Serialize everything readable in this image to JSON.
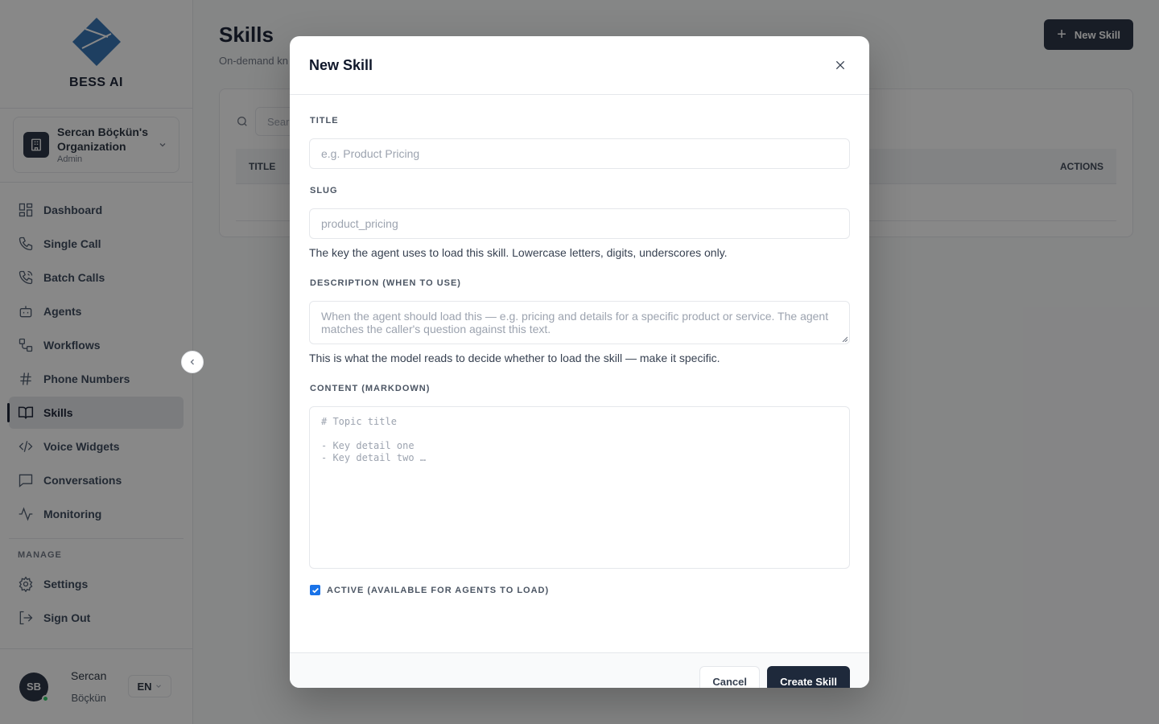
{
  "brand": {
    "name": "BESS AI"
  },
  "org": {
    "name": "Sercan Böçkün's Organization",
    "role": "Admin"
  },
  "nav": {
    "items": [
      {
        "label": "Dashboard",
        "icon": "dashboard-icon"
      },
      {
        "label": "Single Call",
        "icon": "phone-icon"
      },
      {
        "label": "Batch Calls",
        "icon": "phone-calls-icon"
      },
      {
        "label": "Agents",
        "icon": "bot-icon"
      },
      {
        "label": "Workflows",
        "icon": "workflow-icon"
      },
      {
        "label": "Phone Numbers",
        "icon": "hash-icon"
      },
      {
        "label": "Skills",
        "icon": "book-icon",
        "active": true
      },
      {
        "label": "Voice Widgets",
        "icon": "code-icon"
      },
      {
        "label": "Conversations",
        "icon": "chat-icon"
      },
      {
        "label": "Monitoring",
        "icon": "activity-icon"
      }
    ],
    "manage_label": "MANAGE",
    "manage_items": [
      {
        "label": "Settings",
        "icon": "gear-icon"
      },
      {
        "label": "Sign Out",
        "icon": "sign-out-icon"
      }
    ]
  },
  "user": {
    "initials": "SB",
    "first_name": "Sercan",
    "last_name": "Böçkün",
    "language": "EN"
  },
  "page": {
    "title": "Skills",
    "subtitle": "On-demand kn",
    "new_button": "New Skill",
    "search_placeholder": "Sear",
    "columns": {
      "title": "TITLE",
      "actions": "ACTIONS"
    }
  },
  "modal": {
    "title": "New Skill",
    "title_label": "TITLE",
    "title_placeholder": "e.g. Product Pricing",
    "slug_label": "SLUG",
    "slug_placeholder": "product_pricing",
    "slug_help": "The key the agent uses to load this skill. Lowercase letters, digits, underscores only.",
    "description_label": "DESCRIPTION (WHEN TO USE)",
    "description_placeholder": "When the agent should load this — e.g. pricing and details for a specific product or service. The agent matches the caller's question against this text.",
    "description_help": "This is what the model reads to decide whether to load the skill — make it specific.",
    "content_label": "CONTENT (MARKDOWN)",
    "content_placeholder": "# Topic title\n\n- Key detail one\n- Key detail two …",
    "active_label": "ACTIVE (AVAILABLE FOR AGENTS TO LOAD)",
    "active_checked": true,
    "cancel_button": "Cancel",
    "create_button": "Create Skill"
  },
  "colors": {
    "primary": "#1e293b",
    "checkbox": "#1a73e8",
    "online": "#22c55e"
  }
}
